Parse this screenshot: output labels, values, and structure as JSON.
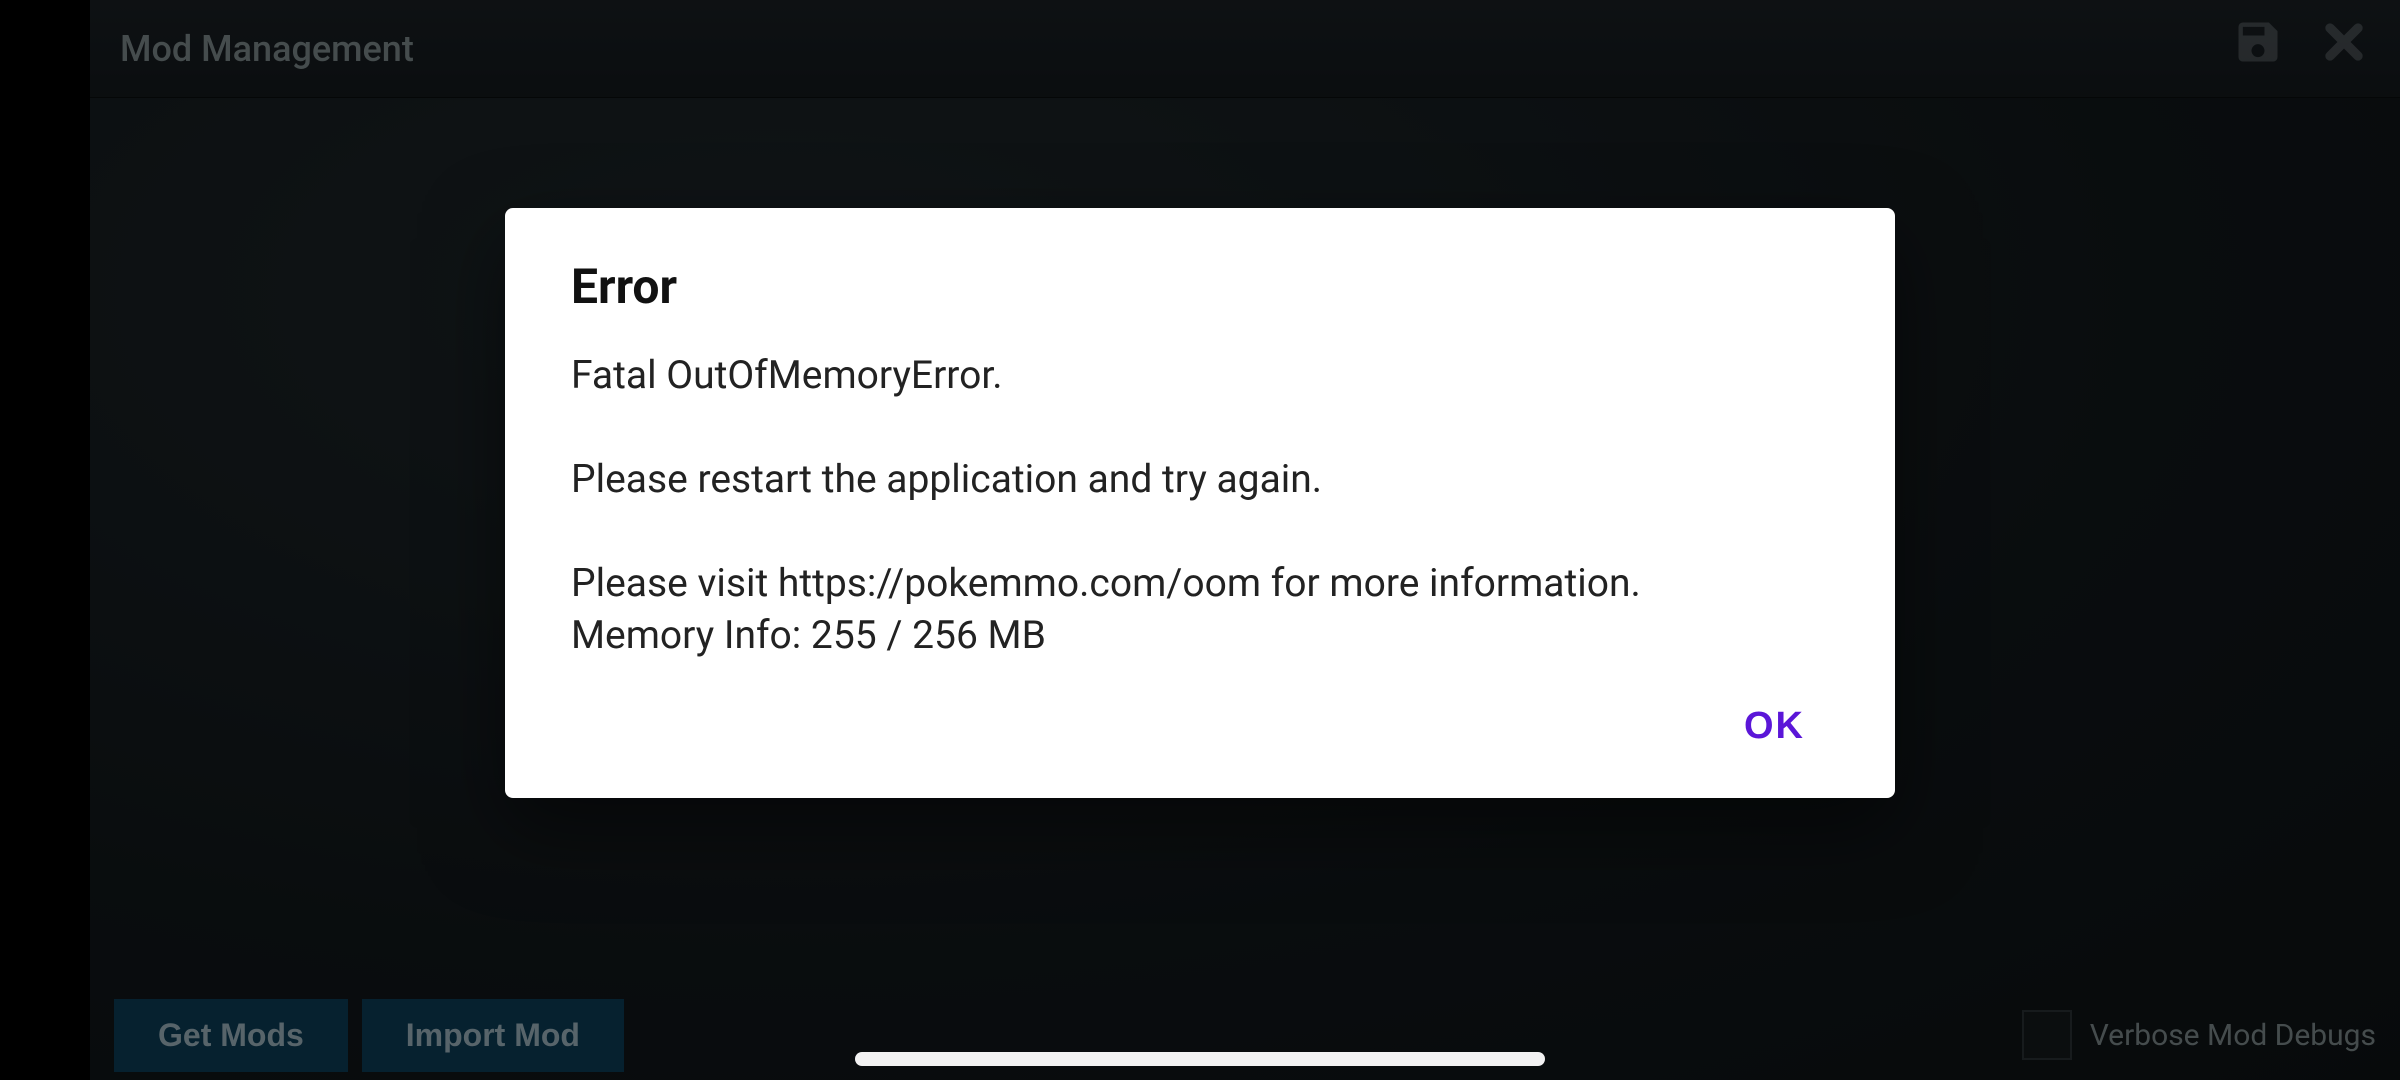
{
  "header": {
    "title": "Mod Management"
  },
  "footer": {
    "get_mods_label": "Get Mods",
    "import_mod_label": "Import Mod",
    "verbose_label": "Verbose Mod Debugs"
  },
  "dialog": {
    "title": "Error",
    "line1": "Fatal OutOfMemoryError.",
    "line2": "Please restart the application and try again.",
    "line3": "Please visit https://pokemmo.com/oom for more information.",
    "line4": "Memory Info: 255 / 256 MB",
    "ok_label": "OK"
  }
}
